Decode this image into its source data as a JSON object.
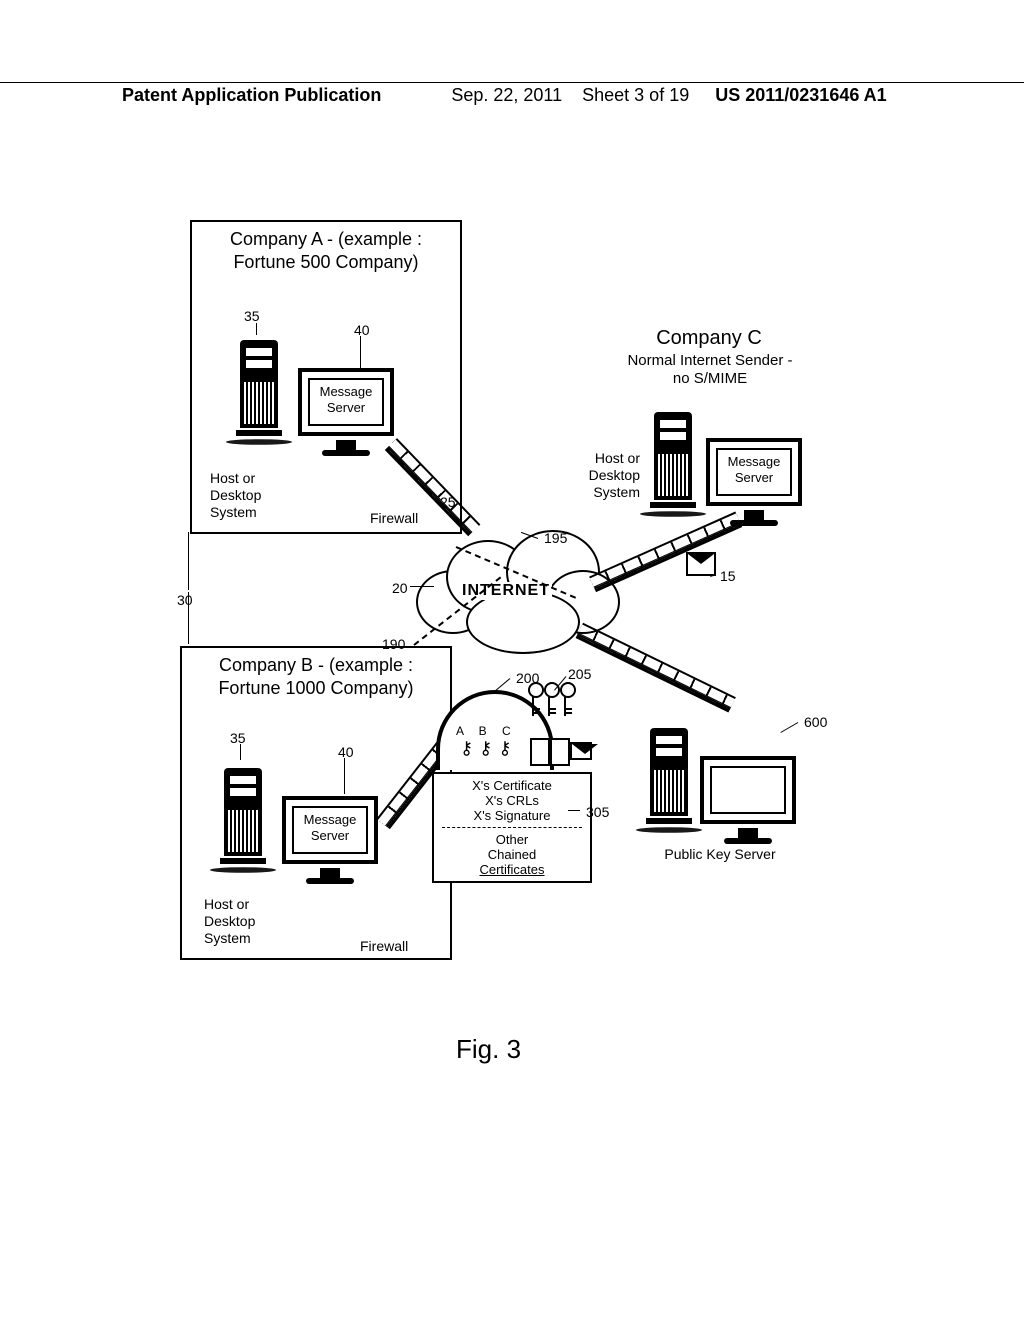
{
  "header": {
    "pub_label": "Patent Application Publication",
    "date": "Sep. 22, 2011",
    "sheet": "Sheet 3 of 19",
    "pubno": "US 2011/0231646 A1"
  },
  "companyA": {
    "title_l1": "Company A - (example :",
    "title_l2": "Fortune 500 Company)",
    "host_label_l1": "Host or",
    "host_label_l2": "Desktop",
    "host_label_l3": "System",
    "msg_server_l1": "Message",
    "msg_server_l2": "Server",
    "firewall": "Firewall",
    "ref35": "35",
    "ref40": "40",
    "ref25": "25",
    "ref30": "30"
  },
  "companyB": {
    "title_l1": "Company B - (example :",
    "title_l2": "Fortune 1000 Company)",
    "host_label_l1": "Host or",
    "host_label_l2": "Desktop",
    "host_label_l3": "System",
    "msg_server_l1": "Message",
    "msg_server_l2": "Server",
    "firewall": "Firewall",
    "ref35": "35",
    "ref40": "40"
  },
  "companyC": {
    "title": "Company C",
    "sub_l1": "Normal Internet Sender -",
    "sub_l2": "no S/MIME",
    "host_label_l1": "Host or",
    "host_label_l2": "Desktop",
    "host_label_l3": "System",
    "msg_server_l1": "Message",
    "msg_server_l2": "Server",
    "ref15": "15"
  },
  "internet": {
    "label": "INTERNET",
    "ref20": "20",
    "ref190": "190",
    "ref195": "195"
  },
  "pki": {
    "ref200": "200",
    "ref205": "205",
    "abc": "A  B  C",
    "cert_l1": "X's Certificate",
    "cert_l2": "X's CRLs",
    "cert_l3": "X's Signature",
    "chain_l1": "Other",
    "chain_l2": "Chained",
    "chain_l3": "Certificates",
    "ref305": "305"
  },
  "pks": {
    "label": "Public Key Server",
    "ref600": "600"
  },
  "figure": "Fig. 3"
}
